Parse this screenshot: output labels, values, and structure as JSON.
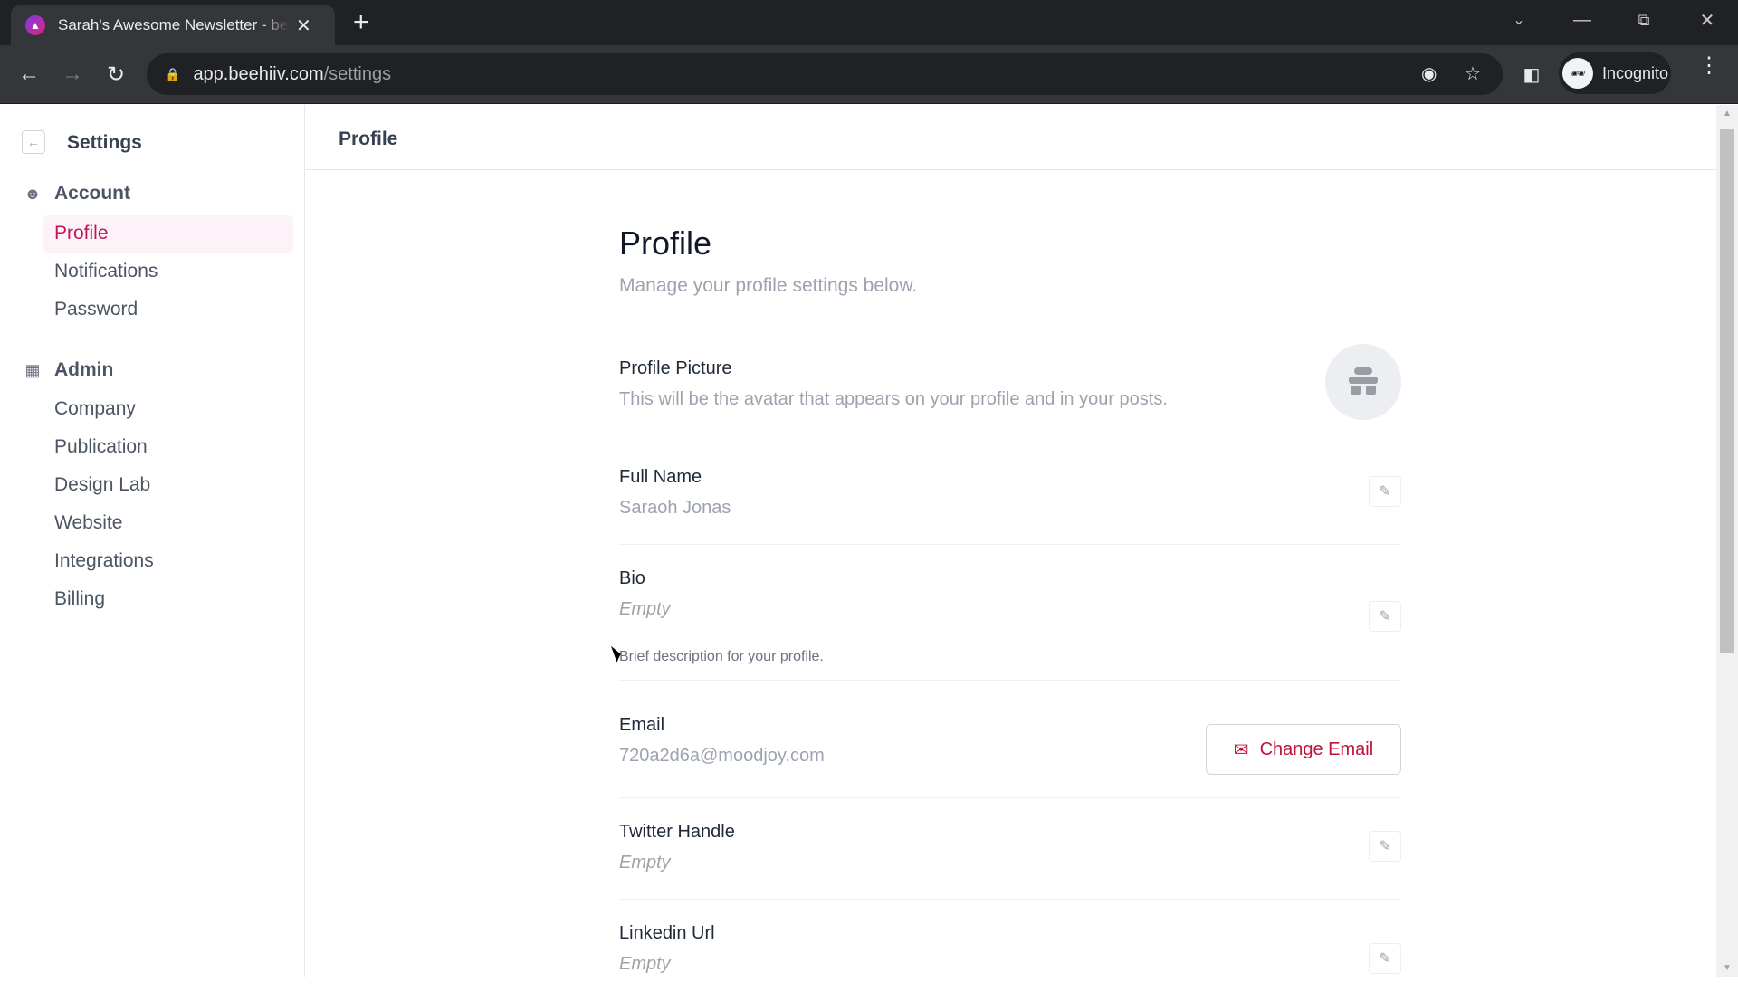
{
  "browser": {
    "tab_title": "Sarah's Awesome Newsletter - beehiiv",
    "url_host": "app.beehiiv.com",
    "url_path": "/settings",
    "profile_label": "Incognito"
  },
  "sidebar": {
    "title": "Settings",
    "groups": [
      {
        "label": "Account",
        "icon": "user-circle-icon",
        "items": [
          {
            "label": "Profile",
            "active": true
          },
          {
            "label": "Notifications"
          },
          {
            "label": "Password"
          }
        ]
      },
      {
        "label": "Admin",
        "icon": "building-icon",
        "items": [
          {
            "label": "Company"
          },
          {
            "label": "Publication"
          },
          {
            "label": "Design Lab"
          },
          {
            "label": "Website"
          },
          {
            "label": "Integrations"
          },
          {
            "label": "Billing"
          }
        ]
      }
    ]
  },
  "header": {
    "title": "Profile"
  },
  "page": {
    "title": "Profile",
    "subtitle": "Manage your profile settings below.",
    "accent": "#be123c",
    "fields": {
      "picture": {
        "label": "Profile Picture",
        "description": "This will be the avatar that appears on your profile and in your posts."
      },
      "full_name": {
        "label": "Full Name",
        "value": "Saraoh Jonas"
      },
      "bio": {
        "label": "Bio",
        "value": "Empty",
        "help": "Brief description for your profile."
      },
      "email": {
        "label": "Email",
        "value": "720a2d6a@moodjoy.com",
        "button": "Change Email"
      },
      "twitter": {
        "label": "Twitter Handle",
        "value": "Empty"
      },
      "linkedin": {
        "label": "Linkedin Url",
        "value": "Empty"
      }
    }
  }
}
